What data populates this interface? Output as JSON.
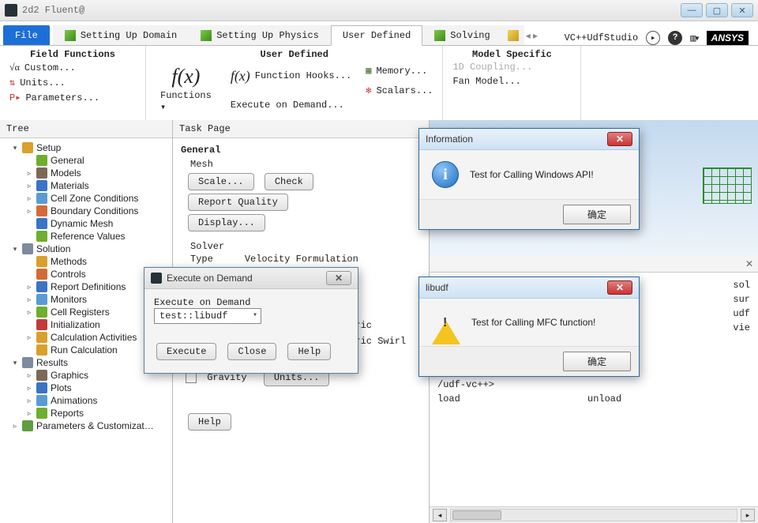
{
  "window": {
    "title": "2d2 Fluent@"
  },
  "tabs": {
    "file": "File",
    "items": [
      "Setting Up Domain",
      "Setting Up Physics",
      "User Defined",
      "Solving"
    ],
    "active": 2,
    "right": {
      "tool": "VC++UdfStudio",
      "logo": "ANSYS"
    }
  },
  "ribbon": {
    "groups": [
      {
        "title": "Field Functions",
        "items": [
          "Custom...",
          "Units...",
          "Parameters..."
        ]
      },
      {
        "title": "User Defined",
        "big": "Functions",
        "col1_big": "f(x)",
        "col2": [
          "Function Hooks...",
          "Execute on Demand..."
        ],
        "col3": [
          "Memory...",
          "Scalars..."
        ]
      },
      {
        "title": "Model Specific",
        "items": [
          "1D Coupling...",
          "Fan Model..."
        ]
      }
    ]
  },
  "tree": {
    "title": "Tree",
    "nodes": [
      {
        "l": 1,
        "exp": "▾",
        "icon": "#d9a02b",
        "label": "Setup"
      },
      {
        "l": 2,
        "icon": "#6fae2e",
        "label": "General"
      },
      {
        "l": 2,
        "tw": "▹",
        "icon": "#7a6a55",
        "label": "Models"
      },
      {
        "l": 2,
        "tw": "▹",
        "icon": "#3a74c4",
        "label": "Materials"
      },
      {
        "l": 2,
        "tw": "▹",
        "icon": "#5a9bd5",
        "label": "Cell Zone Conditions"
      },
      {
        "l": 2,
        "tw": "▹",
        "icon": "#d36a3a",
        "label": "Boundary Conditions"
      },
      {
        "l": 2,
        "icon": "#3a74c4",
        "label": "Dynamic Mesh"
      },
      {
        "l": 2,
        "icon": "#6fae2e",
        "label": "Reference Values"
      },
      {
        "l": 1,
        "exp": "▾",
        "icon": "#7d8aa0",
        "label": "Solution"
      },
      {
        "l": 2,
        "icon": "#d9a02b",
        "label": "Methods"
      },
      {
        "l": 2,
        "icon": "#d36a3a",
        "label": "Controls"
      },
      {
        "l": 2,
        "tw": "▹",
        "icon": "#3a74c4",
        "label": "Report Definitions"
      },
      {
        "l": 2,
        "tw": "▹",
        "icon": "#5a9bd5",
        "label": "Monitors"
      },
      {
        "l": 2,
        "tw": "▹",
        "icon": "#6fae2e",
        "label": "Cell Registers"
      },
      {
        "l": 2,
        "icon": "#c23a3a",
        "label": "Initialization"
      },
      {
        "l": 2,
        "tw": "▹",
        "icon": "#d9a02b",
        "label": "Calculation Activities"
      },
      {
        "l": 2,
        "icon": "#d9a02b",
        "label": "Run Calculation"
      },
      {
        "l": 1,
        "exp": "▾",
        "icon": "#7d8aa0",
        "label": "Results"
      },
      {
        "l": 2,
        "tw": "▹",
        "icon": "#7a6a55",
        "label": "Graphics"
      },
      {
        "l": 2,
        "tw": "▹",
        "icon": "#3a74c4",
        "label": "Plots"
      },
      {
        "l": 2,
        "tw": "▹",
        "icon": "#5a9bd5",
        "label": "Animations"
      },
      {
        "l": 2,
        "tw": "▹",
        "icon": "#6fae2e",
        "label": "Reports"
      },
      {
        "l": 1,
        "tw": "▹",
        "icon": "#5f9e3e",
        "label": "Parameters & Customizat…"
      }
    ]
  },
  "task": {
    "title": "Task Page",
    "general": "General",
    "mesh": "Mesh",
    "btns": {
      "scale": "Scale...",
      "check": "Check",
      "quality": "Report Quality",
      "display": "Display...",
      "units": "Units...",
      "help": "Help"
    },
    "solver": "Solver",
    "type": "Type",
    "vform": "Velocity Formulation",
    "extra1": "etric",
    "extra2": "etric Swirl",
    "gravity": "Gravity"
  },
  "eod": {
    "title": "Execute on Demand",
    "label": "Execute on Demand",
    "value": "test::libudf",
    "execute": "Execute",
    "close": "Close",
    "help": "Help"
  },
  "dlg_info": {
    "title": "Information",
    "msg": "Test for Calling Windows API!",
    "ok": "确定"
  },
  "dlg_warn": {
    "title": "libudf",
    "msg": "Test for Calling MFC function!",
    "ok": "确定"
  },
  "console": {
    "frag": [
      "sol",
      "sur",
      "udf",
      "vie"
    ],
    "lines": [
      {
        "a": "/udf-vc++>",
        "b": ""
      },
      {
        "a": "load",
        "b": "unload"
      },
      {
        "a": "",
        "b": ""
      },
      {
        "a": "/udf-vc++>",
        "b": ""
      },
      {
        "a": "load",
        "b": "unload"
      }
    ]
  }
}
